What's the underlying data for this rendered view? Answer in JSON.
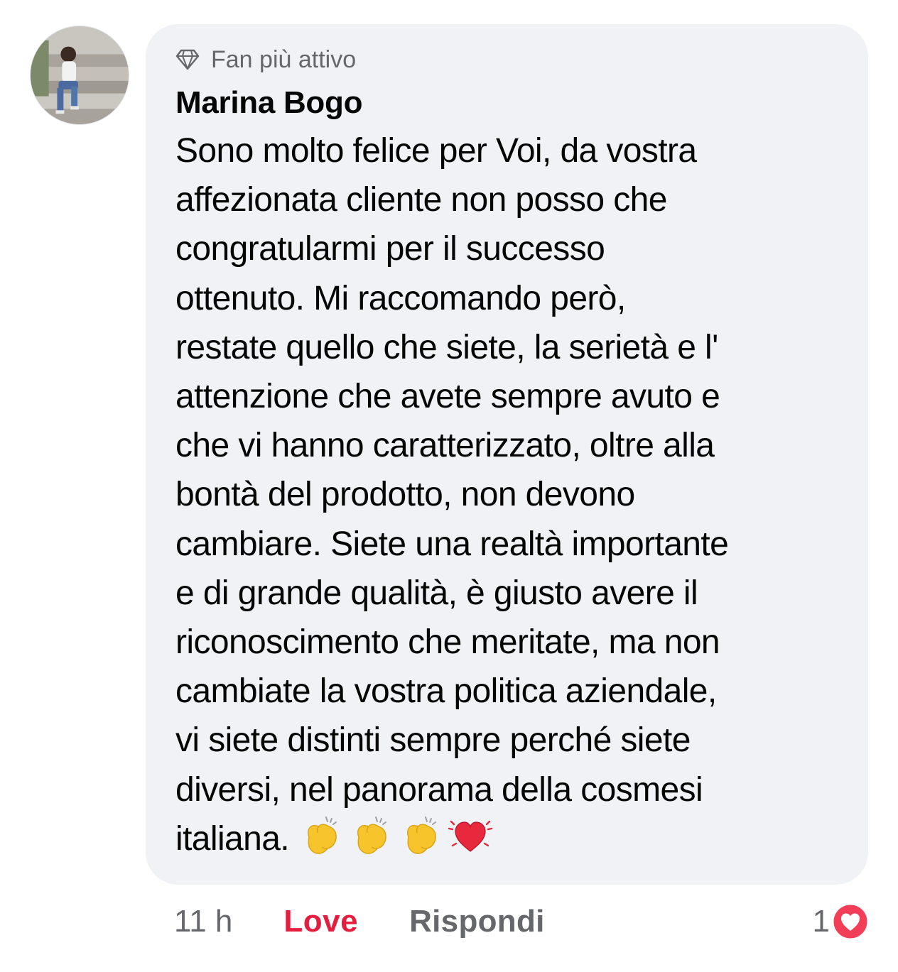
{
  "comment": {
    "badge_label": "Fan più attivo",
    "badge_icon": "diamond-icon",
    "author": "Marina Bogo",
    "lines": [
      "Sono molto felice per Voi, da vostra",
      "affezionata cliente non posso che",
      "congratularmi per il successo",
      "ottenuto. Mi raccomando però,",
      "restate quello che siete, la serietà e l'",
      "attenzione che avete sempre avuto e",
      "che vi hanno caratterizzato, oltre alla",
      "bontà del prodotto, non devono",
      "cambiare. Siete una realtà importante",
      "e di grande qualità, è giusto avere il",
      "riconoscimento che meritate, ma non",
      "cambiate la vostra politica aziendale,",
      "vi siete distinti sempre perché siete",
      "diversi, nel panorama della cosmesi",
      "italiana."
    ],
    "emojis": [
      "clapping-hands-emoji",
      "clapping-hands-emoji",
      "clapping-hands-emoji",
      "beating-heart-emoji"
    ]
  },
  "actions": {
    "time": "11 h",
    "love_label": "Love",
    "reply_label": "Rispondi"
  },
  "reactions": {
    "count": "1",
    "icon": "love-reaction-icon"
  },
  "colors": {
    "bubble_bg": "#f0f2f5",
    "secondary_text": "#65676b",
    "love": "#e41e3f",
    "text": "#050505"
  }
}
